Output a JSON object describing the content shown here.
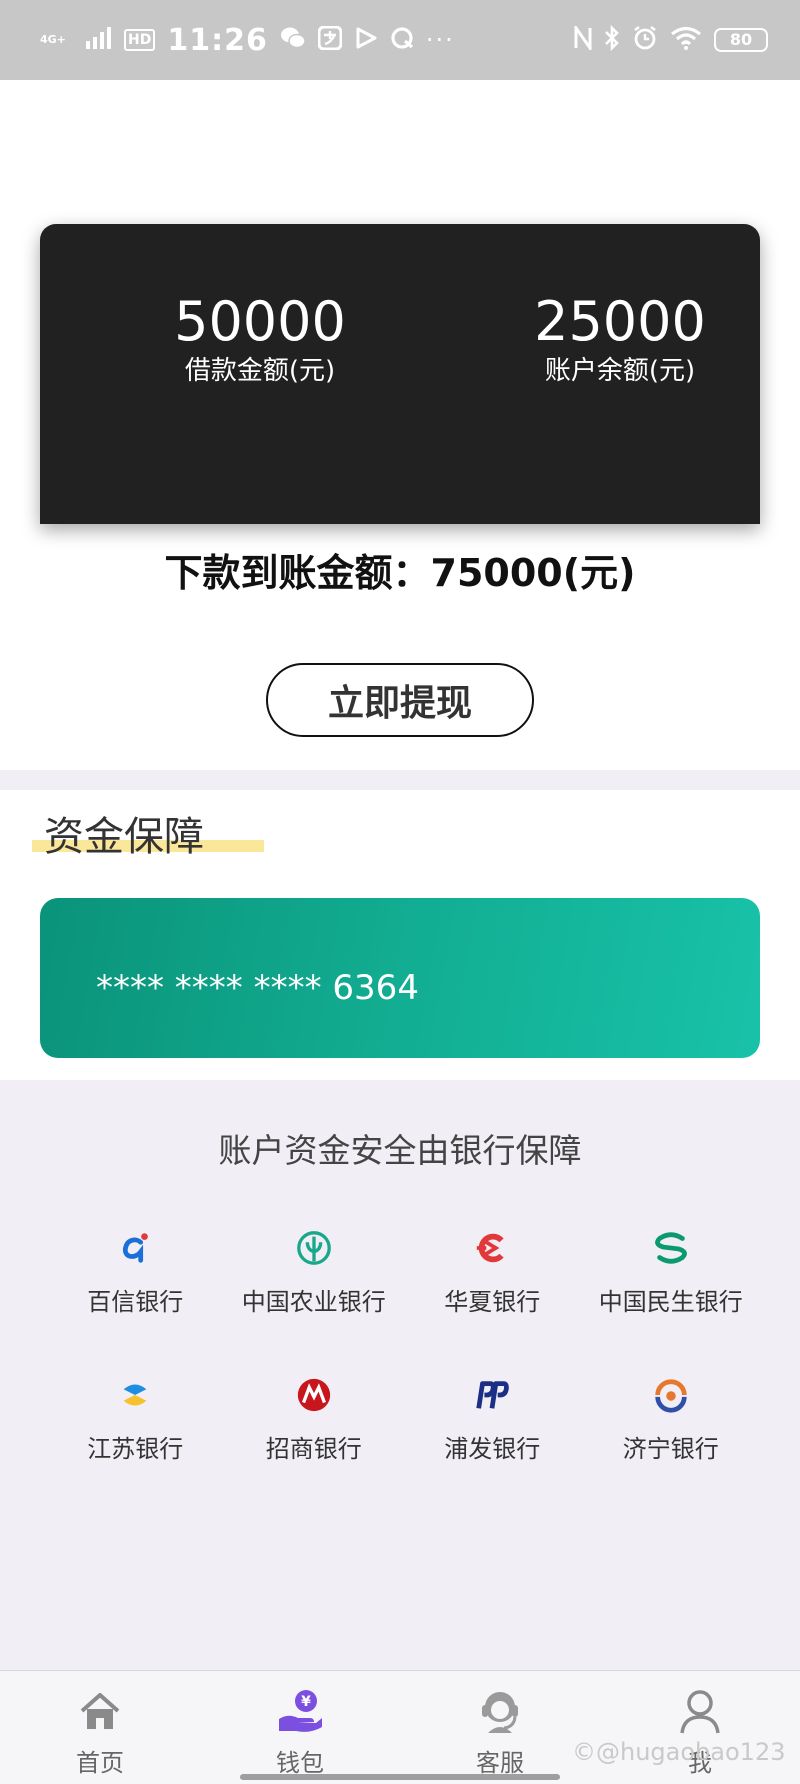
{
  "status_bar": {
    "network": "4G+",
    "hd": "HD",
    "time": "11:26",
    "more": "···",
    "battery": "80",
    "icons": [
      "signal-icon",
      "wechat-icon",
      "alipay-icon",
      "video-icon",
      "browser-icon",
      "nfc-icon",
      "bluetooth-icon",
      "alarm-icon",
      "wifi-icon",
      "battery-icon"
    ]
  },
  "summary": {
    "loan_amount": "50000",
    "loan_label": "借款金额(元)",
    "balance": "25000",
    "balance_label": "账户余额(元)",
    "payout_text": "下款到账金额：75000(元)",
    "withdraw_button": "立即提现"
  },
  "guarantee": {
    "title": "资金保障",
    "card_number": "**** **** **** 6364",
    "caption": "账户资金安全由银行保障"
  },
  "banks": [
    {
      "name": "百信银行",
      "icon": "aibank-logo-icon",
      "color": "#1a6fd8"
    },
    {
      "name": "中国农业银行",
      "icon": "abc-logo-icon",
      "color": "#1aa78b"
    },
    {
      "name": "华夏银行",
      "icon": "hxb-logo-icon",
      "color": "#e2383a"
    },
    {
      "name": "中国民生银行",
      "icon": "cmbc-logo-icon",
      "color": "#0b9a6d"
    },
    {
      "name": "江苏银行",
      "icon": "jsb-logo-icon",
      "color": "#1f8ee0"
    },
    {
      "name": "招商银行",
      "icon": "cmb-logo-icon",
      "color": "#c8161d"
    },
    {
      "name": "浦发银行",
      "icon": "spdb-logo-icon",
      "color": "#1b2f86"
    },
    {
      "name": "济宁银行",
      "icon": "jnb-logo-icon",
      "color": "#e8772e"
    }
  ],
  "nav": [
    {
      "label": "首页",
      "icon": "home-icon"
    },
    {
      "label": "钱包",
      "icon": "wallet-icon"
    },
    {
      "label": "客服",
      "icon": "customer-service-icon"
    },
    {
      "label": "我",
      "icon": "profile-icon"
    }
  ],
  "watermark": "©@hugaobao123",
  "colors": {
    "card_dark": "#212121",
    "card_green": "#12ad92",
    "accent_purple": "#7b4fe0",
    "underline_yellow": "#fbe79a"
  }
}
